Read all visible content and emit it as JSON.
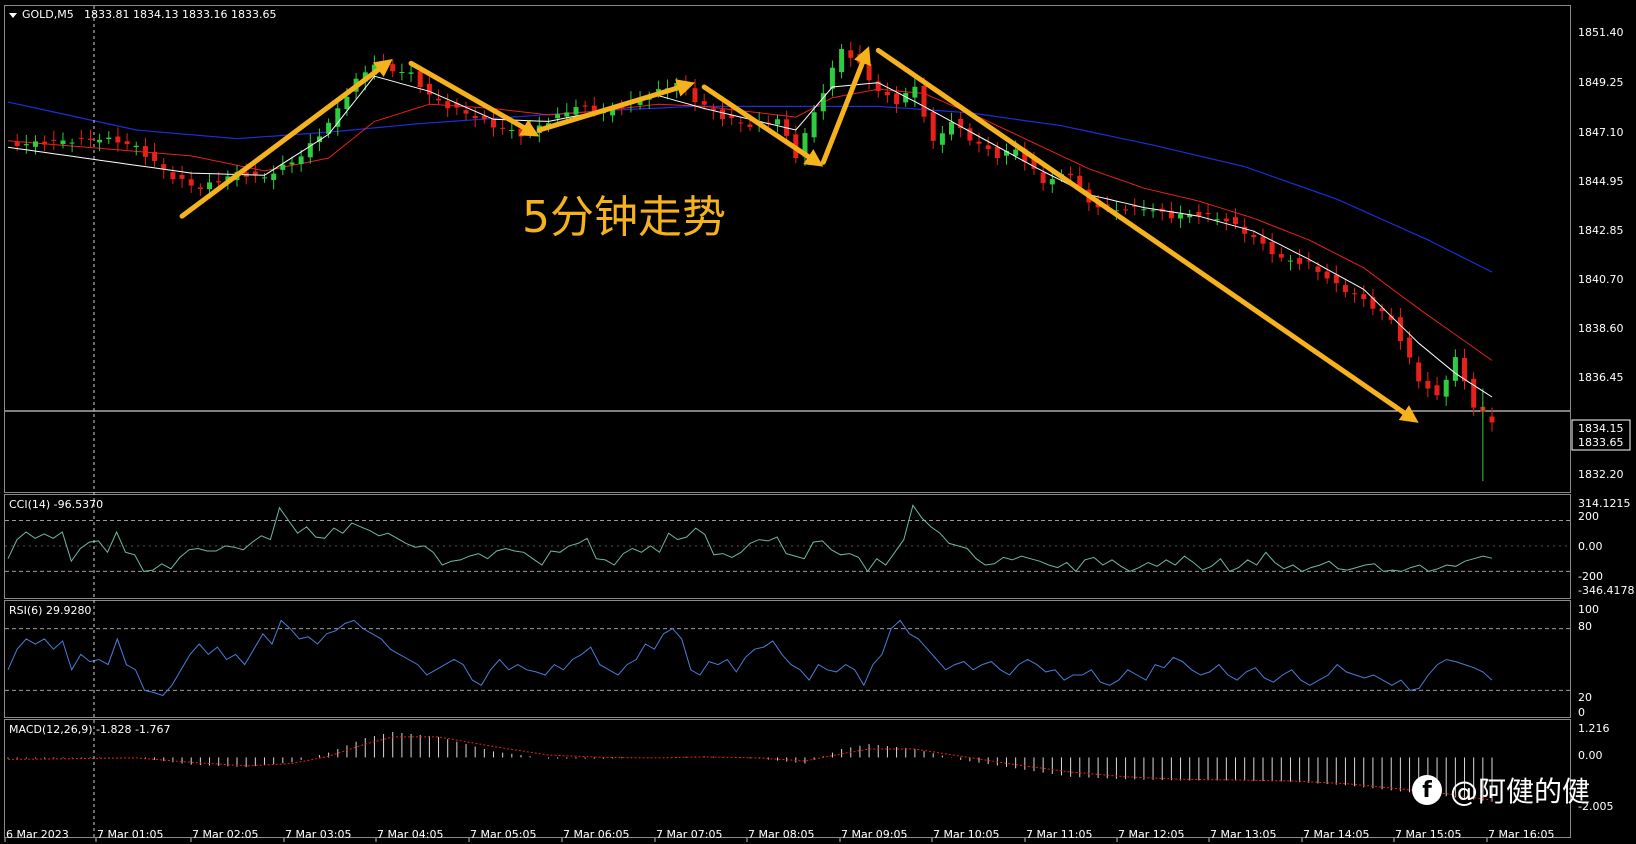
{
  "header": {
    "symbol": "GOLD,M5",
    "ohlc": "1833.81 1834.13 1833.16 1833.65"
  },
  "annotation": "5分钟走势",
  "watermark": "@阿健的健",
  "colors": {
    "background": "#000000",
    "bull": "#2ecc40",
    "bear": "#e8201a",
    "arrow": "#f5b21c",
    "ma_fast": "#ffffff",
    "ma_mid": "#e8201a",
    "ma_slow": "#1a2fd6",
    "indicator": "#4a7dd8",
    "cci": "#6fb8a8"
  },
  "chart_data": [
    {
      "type": "candlestick",
      "title": "GOLD,M5",
      "ylim": [
        1830.8,
        1852.6
      ],
      "y_ticks": [
        "1851.40",
        "1849.25",
        "1847.10",
        "1844.95",
        "1842.85",
        "1840.70",
        "1838.60",
        "1836.45",
        "1834.15",
        "1833.65",
        "1832.20"
      ],
      "price_line": 1834.15,
      "x_labels": [
        "6 Mar 2023",
        "7 Mar 01:05",
        "7 Mar 02:05",
        "7 Mar 03:05",
        "7 Mar 04:05",
        "7 Mar 05:05",
        "7 Mar 06:05",
        "7 Mar 07:05",
        "7 Mar 08:05",
        "7 Mar 09:05",
        "7 Mar 10:05",
        "7 Mar 11:05",
        "7 Mar 12:05",
        "7 Mar 13:05",
        "7 Mar 14:05",
        "7 Mar 15:05",
        "7 Mar 16:05"
      ],
      "close_path": [
        [
          0,
          1846.5
        ],
        [
          10,
          1846.8
        ],
        [
          12,
          1846.7
        ],
        [
          14,
          1846.4
        ],
        [
          18,
          1845.0
        ],
        [
          21,
          1844.5
        ],
        [
          25,
          1845.2
        ],
        [
          28,
          1845.0
        ],
        [
          32,
          1846.0
        ],
        [
          35,
          1847.5
        ],
        [
          38,
          1849.5
        ],
        [
          40,
          1850.3
        ],
        [
          42,
          1850.0
        ],
        [
          44,
          1849.8
        ],
        [
          46,
          1848.8
        ],
        [
          48,
          1848.3
        ],
        [
          50,
          1848.0
        ],
        [
          53,
          1847.4
        ],
        [
          56,
          1847.0
        ],
        [
          59,
          1847.6
        ],
        [
          62,
          1848.3
        ],
        [
          65,
          1848.0
        ],
        [
          68,
          1848.5
        ],
        [
          71,
          1849.0
        ],
        [
          73,
          1849.4
        ],
        [
          75,
          1848.6
        ],
        [
          78,
          1847.8
        ],
        [
          81,
          1847.4
        ],
        [
          84,
          1847.7
        ],
        [
          86,
          1846.0
        ],
        [
          88,
          1848.0
        ],
        [
          90,
          1850.0
        ],
        [
          91,
          1851.0
        ],
        [
          93,
          1850.2
        ],
        [
          95,
          1849.0
        ],
        [
          97,
          1848.5
        ],
        [
          99,
          1849.2
        ],
        [
          101,
          1846.6
        ],
        [
          103,
          1847.6
        ],
        [
          105,
          1846.8
        ],
        [
          108,
          1846.0
        ],
        [
          110,
          1846.3
        ],
        [
          113,
          1844.8
        ],
        [
          116,
          1845.2
        ],
        [
          118,
          1843.8
        ],
        [
          121,
          1843.5
        ],
        [
          124,
          1843.6
        ],
        [
          127,
          1843.2
        ],
        [
          130,
          1843.3
        ],
        [
          133,
          1843.0
        ],
        [
          136,
          1842.2
        ],
        [
          139,
          1841.2
        ],
        [
          142,
          1841.0
        ],
        [
          145,
          1840.0
        ],
        [
          148,
          1839.3
        ],
        [
          151,
          1838.4
        ],
        [
          154,
          1835.6
        ],
        [
          156,
          1834.8
        ],
        [
          158,
          1836.6
        ],
        [
          160,
          1834.4
        ],
        [
          162,
          1833.65
        ]
      ],
      "ma_fast": [
        [
          0,
          1846.4
        ],
        [
          20,
          1845.2
        ],
        [
          28,
          1845.1
        ],
        [
          35,
          1847.0
        ],
        [
          40,
          1849.7
        ],
        [
          46,
          1849.0
        ],
        [
          53,
          1847.7
        ],
        [
          59,
          1847.6
        ],
        [
          65,
          1848.1
        ],
        [
          71,
          1848.8
        ],
        [
          76,
          1848.2
        ],
        [
          82,
          1847.6
        ],
        [
          86,
          1847.2
        ],
        [
          90,
          1849.2
        ],
        [
          95,
          1849.4
        ],
        [
          100,
          1848.3
        ],
        [
          106,
          1846.9
        ],
        [
          112,
          1845.5
        ],
        [
          118,
          1844.2
        ],
        [
          124,
          1843.6
        ],
        [
          130,
          1843.2
        ],
        [
          136,
          1842.5
        ],
        [
          142,
          1841.2
        ],
        [
          148,
          1839.8
        ],
        [
          154,
          1837.3
        ],
        [
          158,
          1835.9
        ],
        [
          162,
          1834.8
        ]
      ],
      "ma_mid": [
        [
          0,
          1846.7
        ],
        [
          20,
          1846.0
        ],
        [
          28,
          1845.3
        ],
        [
          35,
          1845.9
        ],
        [
          40,
          1847.6
        ],
        [
          46,
          1848.4
        ],
        [
          53,
          1848.2
        ],
        [
          59,
          1847.9
        ],
        [
          65,
          1848.1
        ],
        [
          71,
          1848.4
        ],
        [
          76,
          1848.3
        ],
        [
          82,
          1848.0
        ],
        [
          86,
          1847.8
        ],
        [
          90,
          1848.7
        ],
        [
          95,
          1849.1
        ],
        [
          100,
          1848.9
        ],
        [
          106,
          1847.8
        ],
        [
          112,
          1846.6
        ],
        [
          118,
          1845.4
        ],
        [
          124,
          1844.5
        ],
        [
          130,
          1843.9
        ],
        [
          136,
          1843.1
        ],
        [
          142,
          1842.1
        ],
        [
          148,
          1840.8
        ],
        [
          154,
          1838.9
        ],
        [
          158,
          1837.7
        ],
        [
          162,
          1836.5
        ]
      ],
      "ma_slow": [
        [
          0,
          1848.5
        ],
        [
          14,
          1847.2
        ],
        [
          25,
          1846.8
        ],
        [
          35,
          1847.1
        ],
        [
          45,
          1847.5
        ],
        [
          55,
          1847.8
        ],
        [
          65,
          1848.1
        ],
        [
          75,
          1848.3
        ],
        [
          85,
          1848.3
        ],
        [
          95,
          1848.3
        ],
        [
          105,
          1848.0
        ],
        [
          115,
          1847.4
        ],
        [
          125,
          1846.5
        ],
        [
          135,
          1845.5
        ],
        [
          145,
          1844.0
        ],
        [
          155,
          1842.1
        ],
        [
          162,
          1840.6
        ]
      ],
      "trend_arrows": [
        {
          "from": [
            19,
            1843.2
          ],
          "to": [
            42,
            1850.5
          ]
        },
        {
          "from": [
            44,
            1850.3
          ],
          "to": [
            58,
            1846.9
          ]
        },
        {
          "from": [
            58,
            1847.2
          ],
          "to": [
            75,
            1849.4
          ]
        },
        {
          "from": [
            76,
            1849.2
          ],
          "to": [
            89,
            1845.5
          ]
        },
        {
          "from": [
            89,
            1845.7
          ],
          "to": [
            94,
            1851.1
          ]
        },
        {
          "from": [
            95,
            1850.9
          ],
          "to": [
            154,
            1833.6
          ]
        }
      ]
    },
    {
      "type": "line",
      "title": "CCI(14) -96.5370",
      "ylim": [
        -346.4178,
        314.1215
      ],
      "y_ticks": [
        "314.1215",
        "200",
        "0.00",
        "-200",
        "-346.4178"
      ],
      "levels": [
        200,
        -200
      ],
      "values": [
        -100,
        50,
        110,
        60,
        95,
        60,
        110,
        -120,
        -20,
        30,
        40,
        -50,
        110,
        -50,
        -70,
        -200,
        -190,
        -140,
        -180,
        -90,
        -30,
        -20,
        -40,
        -40,
        0,
        -10,
        -30,
        30,
        80,
        50,
        300,
        200,
        100,
        150,
        70,
        60,
        140,
        100,
        180,
        150,
        120,
        80,
        100,
        60,
        20,
        -10,
        0,
        -50,
        -150,
        -120,
        -110,
        -80,
        -60,
        -100,
        -40,
        -20,
        -40,
        -50,
        -100,
        -150,
        -40,
        -50,
        0,
        20,
        60,
        -100,
        -110,
        -150,
        -60,
        -20,
        -50,
        0,
        -50,
        100,
        50,
        70,
        140,
        90,
        -70,
        -60,
        -90,
        -50,
        20,
        50,
        40,
        70,
        -60,
        -80,
        -100,
        30,
        40,
        -30,
        -70,
        -60,
        -90,
        -200,
        -100,
        -150,
        -50,
        50,
        320,
        220,
        150,
        100,
        20,
        0,
        -20,
        -100,
        -150,
        -140,
        -90,
        -110,
        -80,
        -100,
        -120,
        -150,
        -170,
        -130,
        -200,
        -110,
        -90,
        -150,
        -110,
        -160,
        -200,
        -170,
        -130,
        -160,
        -110,
        -150,
        -80,
        -130,
        -190,
        -160,
        -100,
        -200,
        -170,
        -110,
        -150,
        -50,
        -130,
        -180,
        -150,
        -200,
        -170,
        -150,
        -120,
        -180,
        -190,
        -170,
        -150,
        -140,
        -200,
        -190,
        -200,
        -170,
        -150,
        -200,
        -180,
        -150,
        -160,
        -120,
        -100,
        -80,
        -96.5
      ]
    },
    {
      "type": "line",
      "title": "RSI(6) 29.9280",
      "ylim": [
        0,
        100
      ],
      "y_ticks": [
        "100",
        "80",
        "20",
        "0"
      ],
      "levels": [
        80,
        20
      ],
      "values": [
        40,
        60,
        70,
        65,
        70,
        60,
        68,
        40,
        55,
        48,
        50,
        45,
        70,
        45,
        40,
        20,
        18,
        15,
        25,
        40,
        55,
        65,
        55,
        62,
        50,
        55,
        45,
        60,
        75,
        65,
        88,
        80,
        70,
        72,
        65,
        75,
        78,
        85,
        88,
        80,
        75,
        70,
        60,
        55,
        50,
        45,
        35,
        40,
        45,
        50,
        45,
        30,
        25,
        40,
        50,
        40,
        45,
        40,
        38,
        35,
        45,
        40,
        50,
        55,
        62,
        45,
        40,
        35,
        45,
        50,
        65,
        60,
        75,
        80,
        70,
        40,
        35,
        48,
        45,
        50,
        38,
        52,
        60,
        62,
        68,
        55,
        45,
        40,
        30,
        45,
        40,
        38,
        45,
        40,
        25,
        45,
        55,
        80,
        88,
        75,
        70,
        60,
        50,
        40,
        45,
        48,
        40,
        45,
        48,
        40,
        35,
        45,
        50,
        45,
        38,
        40,
        30,
        35,
        35,
        40,
        28,
        25,
        30,
        40,
        35,
        30,
        45,
        42,
        52,
        48,
        40,
        35,
        38,
        45,
        35,
        30,
        38,
        42,
        32,
        28,
        35,
        40,
        30,
        25,
        30,
        35,
        45,
        38,
        35,
        32,
        35,
        30,
        25,
        30,
        20,
        22,
        35,
        45,
        50,
        48,
        45,
        42,
        38,
        30
      ]
    },
    {
      "type": "bar",
      "title": "MACD(12,26,9) -1.828 -1.767",
      "ylim": [
        -2.005,
        1.216
      ],
      "y_ticks": [
        "1.216",
        "0.00",
        "-2.005"
      ],
      "macd_path": [
        [
          0,
          -0.05
        ],
        [
          14,
          0.0
        ],
        [
          20,
          -0.3
        ],
        [
          26,
          -0.4
        ],
        [
          31,
          -0.2
        ],
        [
          35,
          0.2
        ],
        [
          39,
          0.8
        ],
        [
          42,
          1.05
        ],
        [
          47,
          0.85
        ],
        [
          53,
          0.25
        ],
        [
          59,
          -0.05
        ],
        [
          65,
          -0.05
        ],
        [
          71,
          0.0
        ],
        [
          76,
          0.05
        ],
        [
          82,
          -0.05
        ],
        [
          87,
          -0.25
        ],
        [
          91,
          0.35
        ],
        [
          94,
          0.55
        ],
        [
          99,
          0.35
        ],
        [
          104,
          -0.1
        ],
        [
          110,
          -0.45
        ],
        [
          116,
          -0.8
        ],
        [
          122,
          -0.9
        ],
        [
          128,
          -0.95
        ],
        [
          134,
          -0.95
        ],
        [
          140,
          -1.0
        ],
        [
          146,
          -1.15
        ],
        [
          152,
          -1.4
        ],
        [
          157,
          -1.6
        ],
        [
          162,
          -1.828
        ]
      ],
      "signal_path": [
        [
          0,
          -0.08
        ],
        [
          14,
          -0.02
        ],
        [
          20,
          -0.2
        ],
        [
          26,
          -0.35
        ],
        [
          31,
          -0.25
        ],
        [
          35,
          0.05
        ],
        [
          39,
          0.55
        ],
        [
          42,
          0.85
        ],
        [
          47,
          0.85
        ],
        [
          53,
          0.45
        ],
        [
          59,
          0.1
        ],
        [
          65,
          0.0
        ],
        [
          71,
          -0.02
        ],
        [
          76,
          0.02
        ],
        [
          82,
          -0.02
        ],
        [
          87,
          -0.15
        ],
        [
          91,
          0.15
        ],
        [
          94,
          0.35
        ],
        [
          99,
          0.35
        ],
        [
          104,
          0.05
        ],
        [
          110,
          -0.3
        ],
        [
          116,
          -0.6
        ],
        [
          122,
          -0.8
        ],
        [
          128,
          -0.9
        ],
        [
          134,
          -0.93
        ],
        [
          140,
          -0.97
        ],
        [
          146,
          -1.08
        ],
        [
          152,
          -1.3
        ],
        [
          157,
          -1.5
        ],
        [
          162,
          -1.767
        ]
      ]
    }
  ]
}
